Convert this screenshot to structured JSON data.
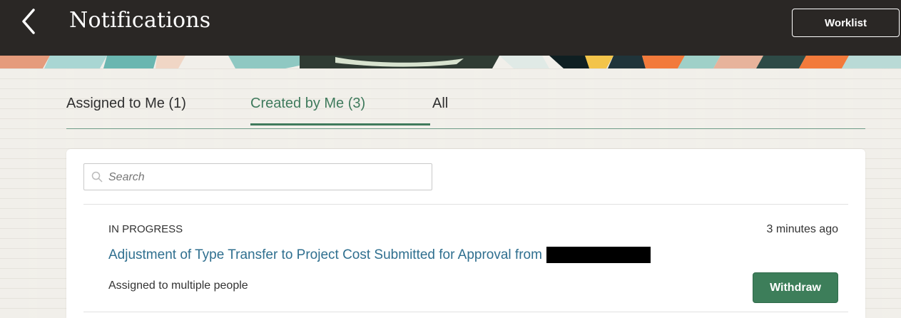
{
  "header": {
    "title": "Notifications",
    "back_icon": "chevron-left-icon",
    "worklist_label": "Worklist"
  },
  "tabs": [
    {
      "label": "Assigned to Me (1)",
      "selected": false
    },
    {
      "label": "Created by Me (3)",
      "selected": true
    },
    {
      "label": "All",
      "selected": false
    }
  ],
  "search": {
    "placeholder": "Search",
    "value": "",
    "icon": "search-icon"
  },
  "notifications": [
    {
      "status": "IN PROGRESS",
      "time": "3 minutes ago",
      "title": "Adjustment of Type Transfer to Project Cost Submitted for Approval from",
      "assigned_to": "Assigned to multiple people",
      "action_label": "Withdraw"
    }
  ],
  "colors": {
    "header_bg": "#2a2725",
    "accent_green": "#3d7e5a",
    "link_blue": "#2f6f8f",
    "page_bg": "#f1efea"
  }
}
